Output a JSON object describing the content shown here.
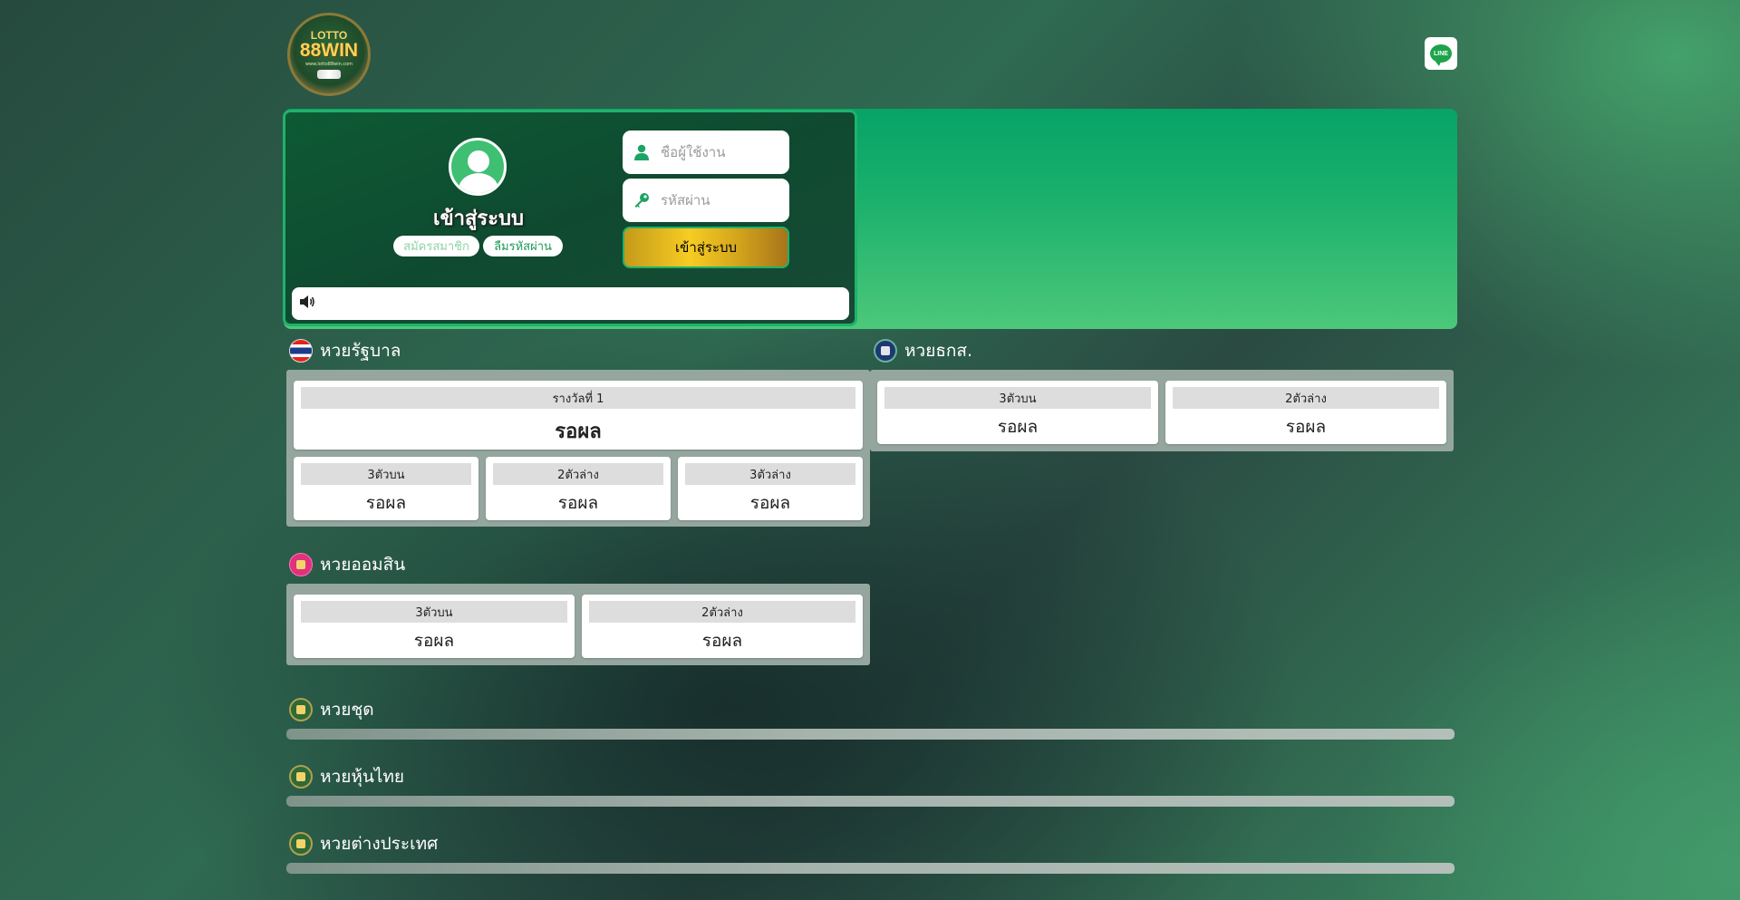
{
  "header": {
    "logo_text_top": "LOTTO",
    "logo_text_main": "88WIN",
    "logo_url": "www.lotto88win.com",
    "line_label": "LINE"
  },
  "login": {
    "title": "เข้าสู่ระบบ",
    "register_label": "สมัครสมาชิก",
    "forgot_label": "ลืมรหัสผ่าน",
    "username_placeholder": "ชื่อผู้ใช้งาน",
    "password_placeholder": "รหัสผ่าน",
    "submit_label": "เข้าสู่ระบบ"
  },
  "sections": {
    "government": {
      "title": "หวยรัฐบาล",
      "first_prize_label": "รางวัลที่ 1",
      "first_prize_value": "รอผล",
      "three_top_label": "3ตัวบน",
      "three_top_value": "รอผล",
      "two_bottom_label": "2ตัวล่าง",
      "two_bottom_value": "รอผล",
      "three_bottom_label": "3ตัวล่าง",
      "three_bottom_value": "รอผล"
    },
    "baac": {
      "title": "หวยธกส.",
      "three_top_label": "3ตัวบน",
      "three_top_value": "รอผล",
      "two_bottom_label": "2ตัวล่าง",
      "two_bottom_value": "รอผล"
    },
    "gsb": {
      "title": "หวยออมสิน",
      "three_top_label": "3ตัวบน",
      "three_top_value": "รอผล",
      "two_bottom_label": "2ตัวล่าง",
      "two_bottom_value": "รอผล"
    },
    "set": {
      "title": "หวยชุด"
    },
    "thai_stock": {
      "title": "หวยหุ้นไทย"
    },
    "foreign": {
      "title": "หวยต่างประเทศ"
    }
  },
  "colors": {
    "hero_green": "#07a367",
    "panel_gray": "#95a69f",
    "gold_button": "#f7cc23",
    "line_green": "#1ea34a"
  },
  "icons": [
    "user-icon",
    "key-icon",
    "speaker-icon",
    "line-icon",
    "avatar-icon"
  ]
}
